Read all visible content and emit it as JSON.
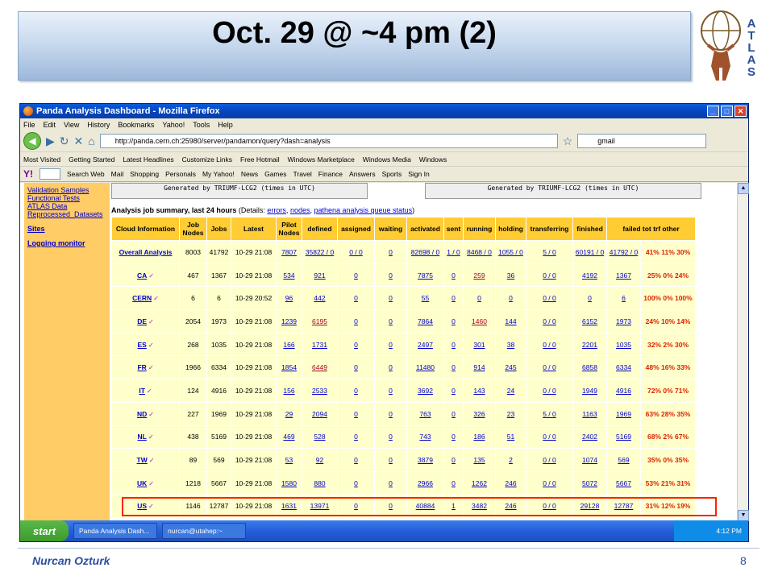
{
  "slide": {
    "title": "Oct. 29 @ ~4 pm (2)",
    "author": "Nurcan Ozturk",
    "page_number": "8",
    "logo_letters": [
      "A",
      "T",
      "L",
      "A",
      "S"
    ]
  },
  "browser": {
    "title": "Panda Analysis Dashboard - Mozilla Firefox",
    "menu": [
      "File",
      "Edit",
      "View",
      "History",
      "Bookmarks",
      "Yahoo!",
      "Tools",
      "Help"
    ],
    "url": "http://panda.cern.ch:25980/server/pandamon/query?dash=analysis",
    "search_value": "gmail",
    "bookmarks": [
      "Most Visited",
      "Getting Started",
      "Latest Headlines",
      "Customize Links",
      "Free Hotmail",
      "Windows Marketplace",
      "Windows Media",
      "Windows"
    ],
    "yahoo_toolbar": [
      "Search Web",
      "Mail",
      "Shopping",
      "Personals",
      "My Yahoo!",
      "News",
      "Games",
      "Travel",
      "Finance",
      "Answers",
      "Sports",
      "Sign In"
    ]
  },
  "sidebar": {
    "links": [
      "Validation Samples",
      "Functional Tests",
      "ATLAS Data",
      "Reprocessed_Datasets"
    ],
    "sites": "Sites",
    "logging": "Logging monitor"
  },
  "page": {
    "generated_left": "Generated by TRIUMF-LCG2 (times in UTC)",
    "generated_right": "Generated by TRIUMF-LCG2 (times in UTC)",
    "summary_prefix": "Analysis job summary, last 24 hours",
    "summary_details": " (Details: ",
    "link_errors": "errors",
    "link_nodes": "nodes",
    "link_queue": "pathena analysis queue status",
    "summary_suffix": ")"
  },
  "table": {
    "headers": [
      "Cloud Information",
      "Job Nodes",
      "Jobs",
      "Latest",
      "Pilot Nodes",
      "defined",
      "assigned",
      "waiting",
      "activated",
      "sent",
      "running",
      "holding",
      "transferring",
      "finished",
      "failed tot trf other"
    ],
    "rows": [
      {
        "cloud": "Overall Analysis",
        "check": false,
        "job_nodes": "8003",
        "jobs": "41792",
        "latest": "10-29 21:08",
        "pilot": "7807",
        "defined": "35822 / 0",
        "assigned": "0 / 0",
        "waiting": "0",
        "activated": "82698 / 0",
        "sent": "1 / 0",
        "running": "8468 / 0",
        "holding": "1055 / 0",
        "transferring": "5 / 0",
        "finished": "60191 / 0",
        "failed": "41792 / 0",
        "pct": "41% 11% 30%"
      },
      {
        "cloud": "CA",
        "check": true,
        "job_nodes": "467",
        "jobs": "1367",
        "latest": "10-29 21:08",
        "pilot": "534",
        "defined": "921",
        "assigned": "0",
        "waiting": "0",
        "activated": "7875",
        "sent": "0",
        "running": "259",
        "holding": "36",
        "transferring": "0 / 0",
        "finished": "4192",
        "failed": "1367",
        "pct": "25% 0% 24%"
      },
      {
        "cloud": "CERN",
        "check": true,
        "job_nodes": "6",
        "jobs": "6",
        "latest": "10-29 20:52",
        "pilot": "96",
        "defined": "442",
        "assigned": "0",
        "waiting": "0",
        "activated": "55",
        "sent": "0",
        "running": "0",
        "holding": "0",
        "transferring": "0 / 0",
        "finished": "0",
        "failed": "6",
        "pct": "100% 0% 100%"
      },
      {
        "cloud": "DE",
        "check": true,
        "job_nodes": "2054",
        "jobs": "1973",
        "latest": "10-29 21:08",
        "pilot": "1239",
        "defined": "6195",
        "assigned": "0",
        "waiting": "0",
        "activated": "7864",
        "sent": "0",
        "running": "1460",
        "holding": "144",
        "transferring": "0 / 0",
        "finished": "6152",
        "failed": "1973",
        "pct": "24% 10% 14%"
      },
      {
        "cloud": "ES",
        "check": true,
        "job_nodes": "268",
        "jobs": "1035",
        "latest": "10-29 21:08",
        "pilot": "166",
        "defined": "1731",
        "assigned": "0",
        "waiting": "0",
        "activated": "2497",
        "sent": "0",
        "running": "301",
        "holding": "38",
        "transferring": "0 / 0",
        "finished": "2201",
        "failed": "1035",
        "pct": "32% 2% 30%"
      },
      {
        "cloud": "FR",
        "check": true,
        "job_nodes": "1966",
        "jobs": "6334",
        "latest": "10-29 21:08",
        "pilot": "1854",
        "defined": "6449",
        "assigned": "0",
        "waiting": "0",
        "activated": "11480",
        "sent": "0",
        "running": "914",
        "holding": "245",
        "transferring": "0 / 0",
        "finished": "6858",
        "failed": "6334",
        "pct": "48% 16% 33%"
      },
      {
        "cloud": "IT",
        "check": true,
        "job_nodes": "124",
        "jobs": "4916",
        "latest": "10-29 21:08",
        "pilot": "156",
        "defined": "2533",
        "assigned": "0",
        "waiting": "0",
        "activated": "3692",
        "sent": "0",
        "running": "143",
        "holding": "24",
        "transferring": "0 / 0",
        "finished": "1949",
        "failed": "4916",
        "pct": "72% 0% 71%"
      },
      {
        "cloud": "ND",
        "check": true,
        "job_nodes": "227",
        "jobs": "1969",
        "latest": "10-29 21:08",
        "pilot": "29",
        "defined": "2094",
        "assigned": "0",
        "waiting": "0",
        "activated": "763",
        "sent": "0",
        "running": "326",
        "holding": "23",
        "transferring": "5 / 0",
        "finished": "1163",
        "failed": "1969",
        "pct": "63% 28% 35%"
      },
      {
        "cloud": "NL",
        "check": true,
        "job_nodes": "438",
        "jobs": "5169",
        "latest": "10-29 21:08",
        "pilot": "469",
        "defined": "528",
        "assigned": "0",
        "waiting": "0",
        "activated": "743",
        "sent": "0",
        "running": "186",
        "holding": "51",
        "transferring": "0 / 0",
        "finished": "2402",
        "failed": "5169",
        "pct": "68% 2% 67%"
      },
      {
        "cloud": "TW",
        "check": true,
        "job_nodes": "89",
        "jobs": "569",
        "latest": "10-29 21:08",
        "pilot": "53",
        "defined": "92",
        "assigned": "0",
        "waiting": "0",
        "activated": "3879",
        "sent": "0",
        "running": "135",
        "holding": "2",
        "transferring": "0 / 0",
        "finished": "1074",
        "failed": "569",
        "pct": "35% 0% 35%"
      },
      {
        "cloud": "UK",
        "check": true,
        "job_nodes": "1218",
        "jobs": "5667",
        "latest": "10-29 21:08",
        "pilot": "1580",
        "defined": "880",
        "assigned": "0",
        "waiting": "0",
        "activated": "2966",
        "sent": "0",
        "running": "1262",
        "holding": "246",
        "transferring": "0 / 0",
        "finished": "5072",
        "failed": "5667",
        "pct": "53% 21% 31%"
      },
      {
        "cloud": "US",
        "check": true,
        "job_nodes": "1146",
        "jobs": "12787",
        "latest": "10-29 21:08",
        "pilot": "1631",
        "defined": "13971",
        "assigned": "0",
        "waiting": "0",
        "activated": "40884",
        "sent": "1",
        "running": "3482",
        "holding": "246",
        "transferring": "0 / 0",
        "finished": "29128",
        "failed": "12787",
        "pct": "31% 12% 19%"
      }
    ]
  },
  "taskbar": {
    "start": "start",
    "tasks": [
      "Panda Analysis Dash...",
      "nurcan@utahep:~"
    ],
    "clock": "4:12 PM"
  },
  "colors": {
    "header_bg": "#ffcc33",
    "cell_bg": "#ffffcc",
    "sidebar_bg": "#ffcc66",
    "highlight": "#ff2200",
    "title_blue": "#2b4fa0"
  }
}
